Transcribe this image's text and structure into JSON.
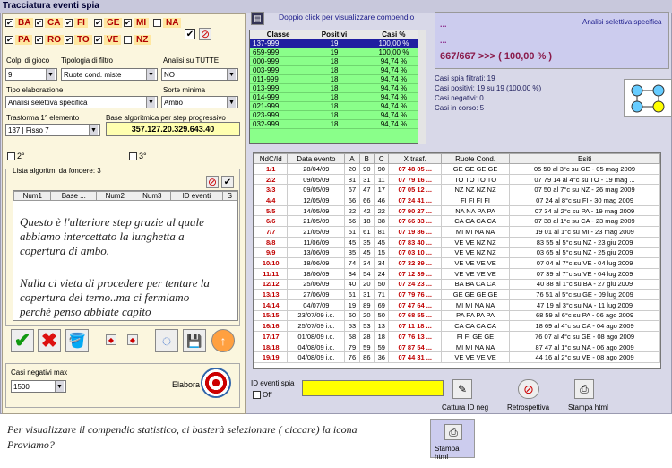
{
  "window": {
    "title": "Tracciatura eventi spia"
  },
  "balls": [
    {
      "label": "BA",
      "checked": true
    },
    {
      "label": "CA",
      "checked": true
    },
    {
      "label": "FI",
      "checked": true
    },
    {
      "label": "GE",
      "checked": true
    },
    {
      "label": "MI",
      "checked": true
    },
    {
      "label": "NA",
      "checked": false
    },
    {
      "label": "PA",
      "checked": true
    },
    {
      "label": "RO",
      "checked": true
    },
    {
      "label": "TO",
      "checked": true
    },
    {
      "label": "VE",
      "checked": true
    },
    {
      "label": "NZ",
      "checked": false
    }
  ],
  "form": {
    "colpi_label": "Colpi di gioco",
    "colpi_value": "9",
    "tipologia_label": "Tipologia di filtro",
    "tipologia_value": "Ruote cond. miste",
    "analisi_label": "Analisi su TUTTE",
    "analisi_value": "NO",
    "tipo_label": "Tipo elaborazione",
    "tipo_value": "Analisi selettiva specifica",
    "sorte_label": "Sorte minima",
    "sorte_value": "Ambo",
    "trasforma_label": "Trasforma 1° elemento",
    "trasforma_value": "137 | Fisso 7",
    "base_label": "Base algoritmica per step progressivo",
    "base_value": "357.127.20.329.643.40",
    "opt2": "2°",
    "opt3": "3°",
    "lista_label": "Lista algoritmi da fondere: 3",
    "lista_cols": [
      "Num1",
      "Base ...",
      "Num2",
      "Num3",
      "ID eventi",
      "S"
    ],
    "casi_label": "Casi negativi max",
    "casi_value": "1500",
    "elabora_label": "Elabora"
  },
  "note1": "Questo è l'ulteriore step grazie al quale abbiamo intercettato la lunghetta a copertura di ambo.",
  "note2": "Nulla ci vieta di procedere per tentare la copertura del terno..ma ci fermiamo perchè penso abbiate capito",
  "compendio_hint": "Doppio click per visualizzare compendio",
  "class_table": {
    "cols": [
      "Classe",
      "Positivi",
      "Casi %"
    ],
    "rows": [
      [
        "137-999",
        "19",
        "100,00 %"
      ],
      [
        "659-999",
        "19",
        "100,00 %"
      ],
      [
        "000-999",
        "18",
        "94,74 %"
      ],
      [
        "003-999",
        "18",
        "94,74 %"
      ],
      [
        "011-999",
        "18",
        "94,74 %"
      ],
      [
        "013-999",
        "18",
        "94,74 %"
      ],
      [
        "014-999",
        "18",
        "94,74 %"
      ],
      [
        "021-999",
        "18",
        "94,74 %"
      ],
      [
        "023-999",
        "18",
        "94,74 %"
      ],
      [
        "032-999",
        "18",
        "94,74 %"
      ]
    ]
  },
  "analisi_panel": {
    "title": "Analisi selettiva specifica",
    "dots": "...",
    "dots2": "...",
    "result": "667/667 >>> ( 100,00 % )"
  },
  "stats": [
    "Casi spia filtrati: 19",
    "Casi positivi: 19 su 19 (100,00 %)",
    "Casi negativi: 0",
    "Casi in corso: 5"
  ],
  "main_table": {
    "cols": [
      "NdC/Id",
      "Data evento",
      "A",
      "B",
      "C",
      "X trasf.",
      "Ruote Cond.",
      "Esiti"
    ],
    "rows": [
      [
        "1/1",
        "28/04/09",
        "20",
        "90",
        "90",
        "07 48 05 ...",
        "GE GE GE GE",
        "05 50 al 3°c su GE - 05 mag 2009"
      ],
      [
        "2/2",
        "09/05/09",
        "81",
        "31",
        "11",
        "07 79 16 ...",
        "TO TO TO TO",
        "07 79 14 al 4°c su TO - 19 mag ..."
      ],
      [
        "3/3",
        "09/05/09",
        "67",
        "47",
        "17",
        "07 05 12 ...",
        "NZ NZ NZ NZ",
        "07 50 al 7°c su NZ - 26 mag 2009"
      ],
      [
        "4/4",
        "12/05/09",
        "66",
        "66",
        "46",
        "07 24 41 ...",
        "FI FI FI FI",
        "07 24 al 8°c su FI - 30 mag 2009"
      ],
      [
        "5/5",
        "14/05/09",
        "22",
        "42",
        "22",
        "07 90 27 ...",
        "NA NA PA PA",
        "07 34 al 2°c su PA - 19 mag 2009"
      ],
      [
        "6/6",
        "21/05/09",
        "66",
        "18",
        "38",
        "07 66 33 ...",
        "CA CA CA CA",
        "07 38 al 1°c su CA - 23 mag 2009"
      ],
      [
        "7/7",
        "21/05/09",
        "51",
        "61",
        "81",
        "07 19 86 ...",
        "MI MI NA NA",
        "19 01 al 1°c su MI - 23 mag 2009"
      ],
      [
        "8/8",
        "11/06/09",
        "45",
        "35",
        "45",
        "07 83 40 ...",
        "VE VE NZ NZ",
        "83 55 al 5°c su NZ - 23 giu 2009"
      ],
      [
        "9/9",
        "13/06/09",
        "35",
        "45",
        "15",
        "07 03 10 ...",
        "VE VE NZ NZ",
        "03 65 al 5°c su NZ - 25 giu 2009"
      ],
      [
        "10/10",
        "18/06/09",
        "74",
        "34",
        "34",
        "07 32 39 ...",
        "VE VE VE VE",
        "07 04 al 7°c su VE - 04 lug 2009"
      ],
      [
        "11/11",
        "18/06/09",
        "34",
        "54",
        "24",
        "07 12 39 ...",
        "VE VE VE VE",
        "07 39 al 7°c su VE - 04 lug 2009"
      ],
      [
        "12/12",
        "25/06/09",
        "40",
        "20",
        "50",
        "07 24 23 ...",
        "BA BA CA CA",
        "40 88 al 1°c su BA - 27 giu 2009"
      ],
      [
        "13/13",
        "27/06/09",
        "61",
        "31",
        "71",
        "07 79 76 ...",
        "GE GE GE GE",
        "76 51 al 5°c su GE - 09 lug 2009"
      ],
      [
        "14/14",
        "04/07/09",
        "19",
        "89",
        "69",
        "07 47 64 ...",
        "MI MI NA NA",
        "47 19 al 3°c su NA - 11 lug 2009"
      ],
      [
        "15/15",
        "23/07/09 i.c.",
        "60",
        "20",
        "50",
        "07 68 55 ...",
        "PA PA PA PA",
        "68 59 al 6°c su PA - 06 ago 2009"
      ],
      [
        "16/16",
        "25/07/09 i.c.",
        "53",
        "53",
        "13",
        "07 11 18 ...",
        "CA CA CA CA",
        "18 69 al 4°c su CA - 04 ago 2009"
      ],
      [
        "17/17",
        "01/08/09 i.c.",
        "58",
        "28",
        "18",
        "07 76 13 ...",
        "FI FI GE GE",
        "76 07 al 4°c su GE - 08 ago 2009"
      ],
      [
        "18/18",
        "04/08/09 i.c.",
        "79",
        "59",
        "59",
        "07 87 54 ...",
        "MI MI NA NA",
        "87 47 al 1°c su NA - 06 ago 2009"
      ],
      [
        "19/19",
        "04/08/09 i.c.",
        "76",
        "86",
        "36",
        "07 44 31 ...",
        "VE VE VE VE",
        "44 16 al 2°c su VE - 08 ago 2009"
      ]
    ]
  },
  "bottom": {
    "id_label": "ID eventi spia",
    "off_label": "Off",
    "cattura": "Cattura ID neg",
    "retro": "Retrospettiva",
    "stampa": "Stampa html"
  },
  "caption1": "Per visualizzare il compendio statistico, ci basterà selezionare ( ciccare) la icona",
  "caption2": "Proviamo?",
  "caption_btn": "Stampa html",
  "colors": {
    "green": "#8aff8a",
    "highlight": "#2020a0",
    "red": "#c00000",
    "yellow": "#ffff00"
  }
}
